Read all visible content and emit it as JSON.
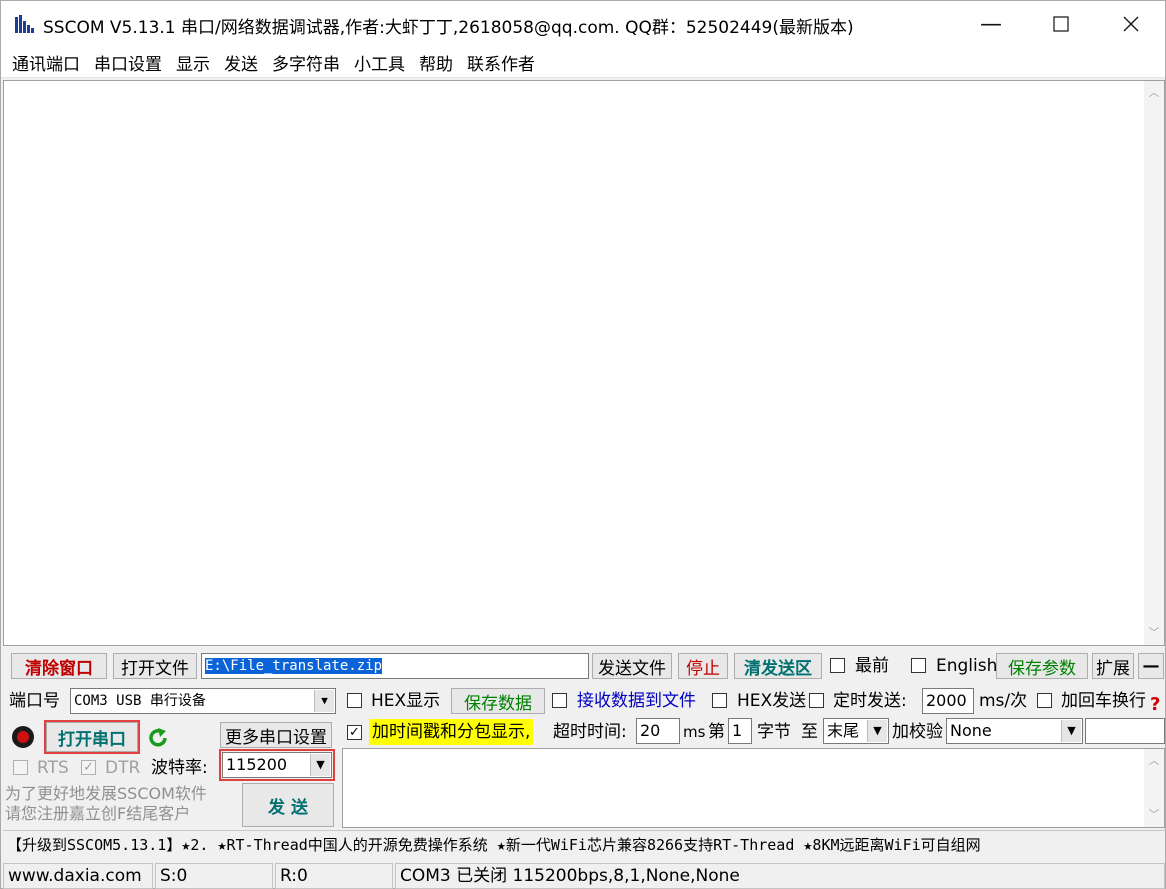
{
  "window": {
    "title": "SSCOM V5.13.1 串口/网络数据调试器,作者:大虾丁丁,2618058@qq.com. QQ群：52502449(最新版本)"
  },
  "menu": [
    "通讯端口",
    "串口设置",
    "显示",
    "发送",
    "多字符串",
    "小工具",
    "帮助",
    "联系作者"
  ],
  "toolbar": {
    "clear_window": "清除窗口",
    "open_file": "打开文件",
    "file_path": "E:\\File_translate.zip",
    "send_file": "发送文件",
    "stop": "停止",
    "clear_send": "清发送区",
    "topmost_label": "最前",
    "topmost_checked": false,
    "english_label": "English",
    "english_checked": false,
    "save_params": "保存参数",
    "expand": "扩展",
    "collapse": "—"
  },
  "port": {
    "port_label": "端口号",
    "port_value": "COM3 USB 串行设备",
    "open_port": "打开串口",
    "more_settings": "更多串口设置",
    "rts_label": "RTS",
    "dtr_label": "DTR",
    "rts_checked": false,
    "dtr_checked": true,
    "baud_label": "波特率:",
    "baud_value": "115200",
    "promo_line1": "为了更好地发展SSCOM软件",
    "promo_line2": "请您注册嘉立创F结尾客户",
    "send": "发  送"
  },
  "options": {
    "hex_display_label": "HEX显示",
    "hex_display_checked": false,
    "save_data": "保存数据",
    "recv_to_file_label": "接收数据到文件",
    "recv_to_file_checked": false,
    "hex_send_label": "HEX发送",
    "hex_send_checked": false,
    "timed_send_label": "定时发送:",
    "timed_send_checked": false,
    "timed_interval": "2000",
    "interval_unit": "ms/次",
    "add_crlf_label": "加回车换行",
    "add_crlf_checked": false,
    "timestamp_label": "加时间戳和分包显示,",
    "timestamp_checked": true,
    "timeout_label": "超时时间:",
    "timeout_value": "20",
    "timeout_unit": "ms",
    "byte_prefix": "第",
    "byte_index": "1",
    "byte_unit": "字节",
    "to_label": "至",
    "to_value": "末尾",
    "checksum_label": "加校验",
    "checksum_value": "None"
  },
  "ticker": "【升级到SSCOM5.13.1】★2. ★RT-Thread中国人的开源免费操作系统 ★新一代WiFi芯片兼容8266支持RT-Thread ★8KM远距离WiFi可自组网",
  "status": {
    "website": "www.daxia.com",
    "sent": "S:0",
    "received": "R:0",
    "port_state": "COM3 已关闭  115200bps,8,1,None,None"
  }
}
